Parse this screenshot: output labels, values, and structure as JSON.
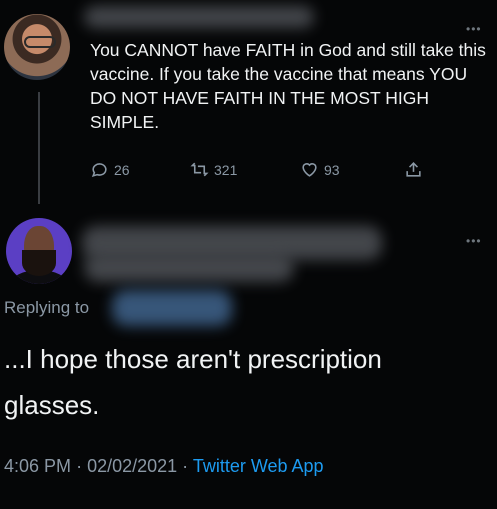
{
  "original_tweet": {
    "text": "You CANNOT have FAITH in God and still take this vaccine. If you take the vaccine that means YOU DO NOT HAVE FAITH IN THE MOST HIGH SIMPLE.",
    "more_icon": "more-dots-icon",
    "actions": {
      "replies": "26",
      "retweets": "321",
      "likes": "93"
    }
  },
  "reply": {
    "replying_to_label": "Replying to",
    "text": "...I hope those aren't prescription glasses.",
    "time": "4:06 PM",
    "date": "02/02/2021",
    "source": "Twitter Web App"
  },
  "colors": {
    "background": "#050607",
    "muted": "#8b98a5",
    "link": "#1d9bf0",
    "avatar_bg": "#5b3fc4"
  }
}
